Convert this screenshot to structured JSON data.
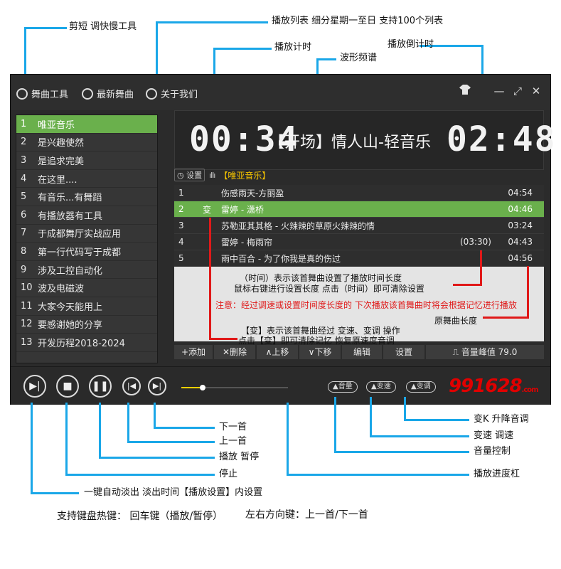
{
  "callouts": {
    "clip": "剪短 调快慢工具",
    "playlist": "播放列表  细分星期一至日  支持100个列表",
    "play_timer": "播放计时",
    "waveform": "波形频谱",
    "countdown": "播放倒计时",
    "change_k": "变K  升降音调",
    "speed": "变速  调速",
    "volume": "音量控制",
    "seekbar": "播放进度杠",
    "next": "下一首",
    "prev": "上一首",
    "play_pause": "播放  暂停",
    "stop": "停止",
    "fade": "一键自动淡出   淡出时间【播放设置】内设置",
    "hotkey_left": "支持键盘热键：  回车键（播放/暂停）",
    "hotkey_right": "左右方向键：上一首/下一首"
  },
  "menu": [
    "舞曲工具",
    "最新舞曲",
    "关于我们"
  ],
  "window_controls": {
    "shirt": "shirt-icon",
    "minimize": "—",
    "maximize": "⤢",
    "close": "✕"
  },
  "playlists": [
    {
      "n": "1",
      "label": "唯亚音乐"
    },
    {
      "n": "2",
      "label": "是兴趣使然"
    },
    {
      "n": "3",
      "label": "是追求完美"
    },
    {
      "n": "4",
      "label": "在这里...."
    },
    {
      "n": "5",
      "label": "有音乐...有舞蹈"
    },
    {
      "n": "6",
      "label": "有播放器有工具"
    },
    {
      "n": "7",
      "label": "于成都舞厅实战应用"
    },
    {
      "n": "8",
      "label": "第一行代码写于成都"
    },
    {
      "n": "9",
      "label": "涉及工控自动化"
    },
    {
      "n": "10",
      "label": "波及电磁波"
    },
    {
      "n": "11",
      "label": "大家今天能用上"
    },
    {
      "n": "12",
      "label": "要感谢她的分享"
    },
    {
      "n": "13",
      "label": "开发历程2018-2024"
    }
  ],
  "display": {
    "elapsed": "00:34",
    "title": "【开场】情人山-轻音乐",
    "remaining": "02:48"
  },
  "settings_label": "设置",
  "current_list": "【唯亚音乐】",
  "songs": [
    {
      "n": "1",
      "flag": "",
      "title": "伤感雨天-方丽盈",
      "extra": "",
      "dur": "04:54"
    },
    {
      "n": "2",
      "flag": "变",
      "title": "雷婷 - 潇桥",
      "extra": "",
      "dur": "04:46"
    },
    {
      "n": "3",
      "flag": "",
      "title": "苏勒亚其其格 - 火辣辣的草原火辣辣的情",
      "extra": "",
      "dur": "03:24"
    },
    {
      "n": "4",
      "flag": "",
      "title": "雷婷 - 梅雨帘",
      "extra": "(03:30)",
      "dur": "04:43"
    },
    {
      "n": "5",
      "flag": "",
      "title": "雨中百合 - 为了你我是真的伤过",
      "extra": "",
      "dur": "04:56"
    }
  ],
  "notes": {
    "n1": "（时间）表示该首舞曲设置了播放时间长度",
    "n2": "鼠标右键进行设置长度     点击（时间）即可清除设置",
    "n3": "注意：经过调速或设置时间度长度的  下次播放该首舞曲时将会根据记忆进行播放",
    "n4": "原舞曲长度",
    "n5": "【变】表示该首舞曲经过  变速、变调 操作",
    "n6": "点击【变】即可清除记忆  恢复原速度音调"
  },
  "toolbar": [
    "+添加",
    "✕删除",
    "∧上移",
    "∨下移",
    "编辑",
    "设置"
  ],
  "peak": {
    "label": "音量峰值",
    "value": "79.0"
  },
  "pills": [
    "▲音量",
    "▲变速",
    "▲变调"
  ],
  "logo": {
    "text": "991628",
    "suffix": ".com"
  },
  "progress": 0.2
}
